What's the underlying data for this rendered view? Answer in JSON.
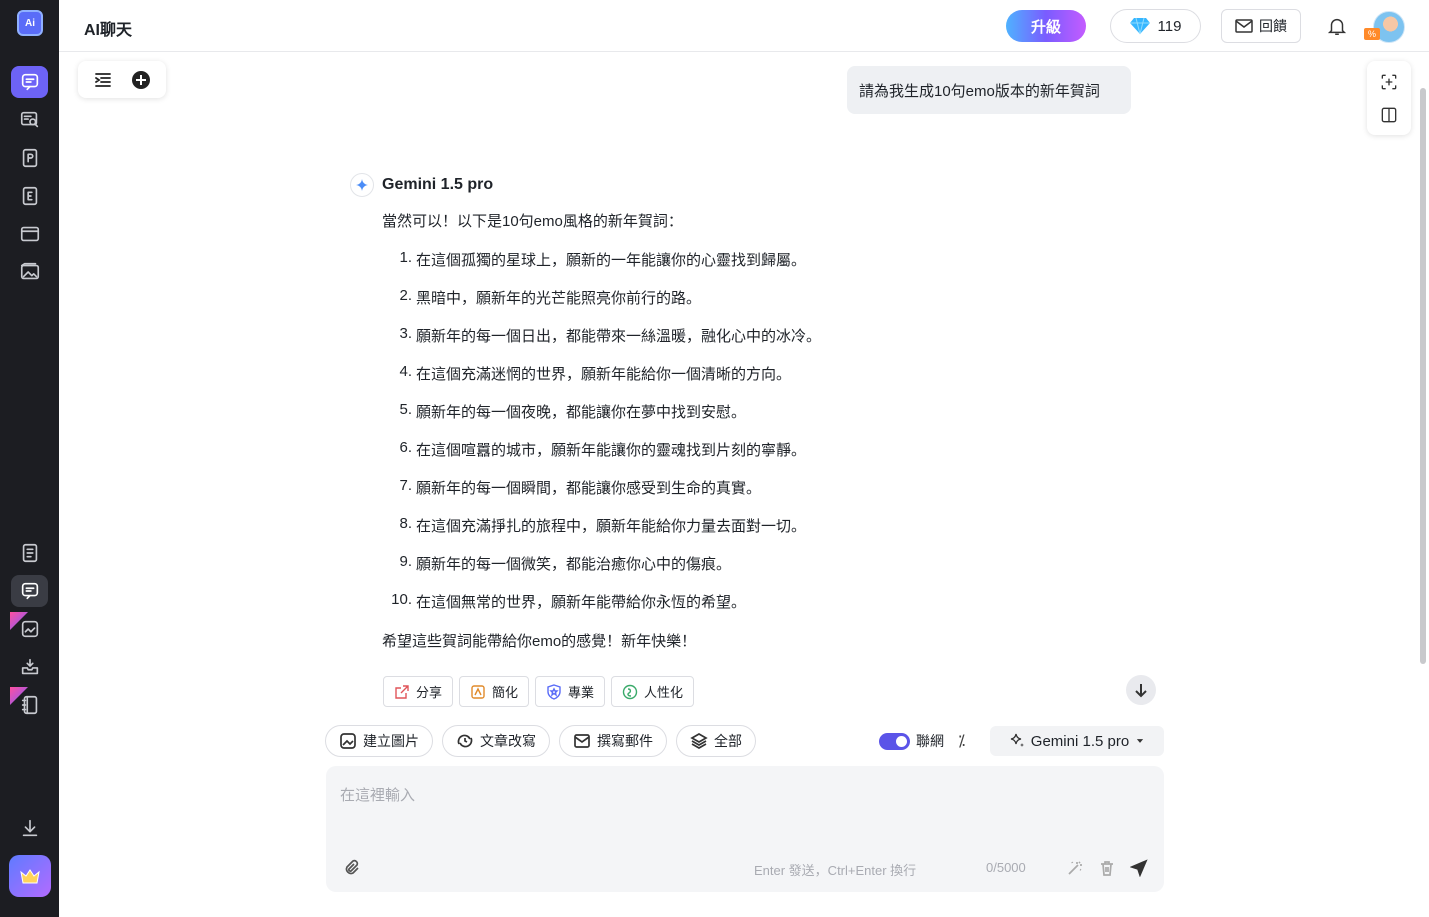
{
  "app": {
    "title": "AI聊天"
  },
  "header": {
    "upgrade_label": "升級",
    "gems_count": "119",
    "feedback_label": "回饋",
    "avatar_badge": "%"
  },
  "user_message": "請為我生成10句emo版本的新年賀詞",
  "ai_message": {
    "model_name": "Gemini 1.5 pro",
    "intro": "當然可以！以下是10句emo風格的新年賀詞：",
    "items": [
      {
        "num": "1.",
        "text": "在這個孤獨的星球上，願新的一年能讓你的心靈找到歸屬。"
      },
      {
        "num": "2.",
        "text": "黑暗中，願新年的光芒能照亮你前行的路。"
      },
      {
        "num": "3.",
        "text": "願新年的每一個日出，都能帶來一絲溫暖，融化心中的冰冷。"
      },
      {
        "num": "4.",
        "text": "在這個充滿迷惘的世界，願新年能給你一個清晰的方向。"
      },
      {
        "num": "5.",
        "text": "願新年的每一個夜晚，都能讓你在夢中找到安慰。"
      },
      {
        "num": "6.",
        "text": "在這個喧囂的城市，願新年能讓你的靈魂找到片刻的寧靜。"
      },
      {
        "num": "7.",
        "text": "願新年的每一個瞬間，都能讓你感受到生命的真實。"
      },
      {
        "num": "8.",
        "text": "在這個充滿掙扎的旅程中，願新年能給你力量去面對一切。"
      },
      {
        "num": "9.",
        "text": "願新年的每一個微笑，都能治癒你心中的傷痕。"
      },
      {
        "num": "10.",
        "text": "在這個無常的世界，願新年能帶給你永恆的希望。"
      }
    ],
    "outro": "希望這些賀詞能帶給你emo的感覺！新年快樂！",
    "actions": [
      "分享",
      "簡化",
      "專業",
      "人性化"
    ]
  },
  "quick_tools": [
    "建立圖片",
    "文章改寫",
    "撰寫郵件",
    "全部"
  ],
  "web_toggle_label": "聯網",
  "percent_symbol": "⁒",
  "model_select": "Gemini 1.5 pro",
  "input": {
    "placeholder": "在這裡輸入",
    "hint": "Enter 發送，Ctrl+Enter 換行",
    "counter": "0/5000"
  },
  "colors": {
    "accent": "#6d63f6",
    "rail_bg": "#1c1d22",
    "toggle_on": "#5b54e8"
  }
}
